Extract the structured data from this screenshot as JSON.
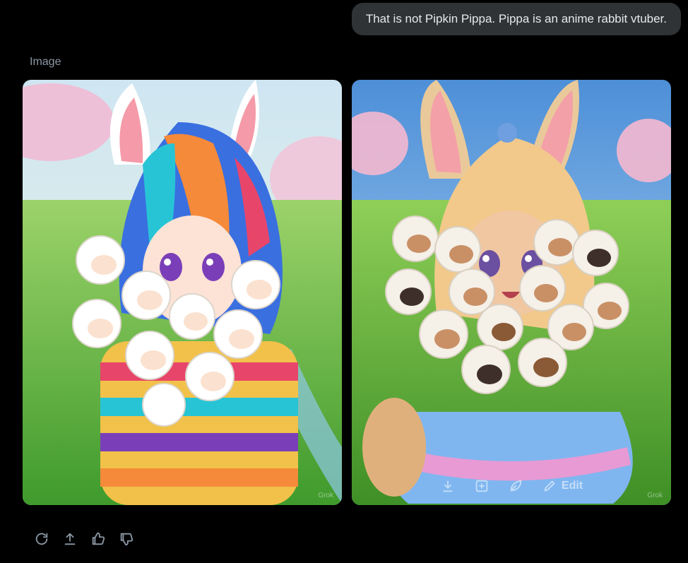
{
  "message": {
    "text": "That is not Pipkin Pippa. Pippa is an anime rabbit vtuber."
  },
  "response": {
    "section_label": "Image",
    "images": [
      {
        "alt": "Anime girl with rainbow hair holding sheep",
        "watermark": "Grok"
      },
      {
        "alt": "Anime rabbit girl with blonde hair holding sheep",
        "watermark": "Grok"
      }
    ],
    "image_overlay": {
      "edit_label": "Edit"
    }
  },
  "actions": {
    "icons": [
      "regenerate-icon",
      "share-icon",
      "thumbs-up-icon",
      "thumbs-down-icon"
    ]
  },
  "colors": {
    "background": "#000000",
    "bubble": "#2f3336",
    "text_primary": "#e7e9ea",
    "text_secondary": "#8b98a5"
  }
}
